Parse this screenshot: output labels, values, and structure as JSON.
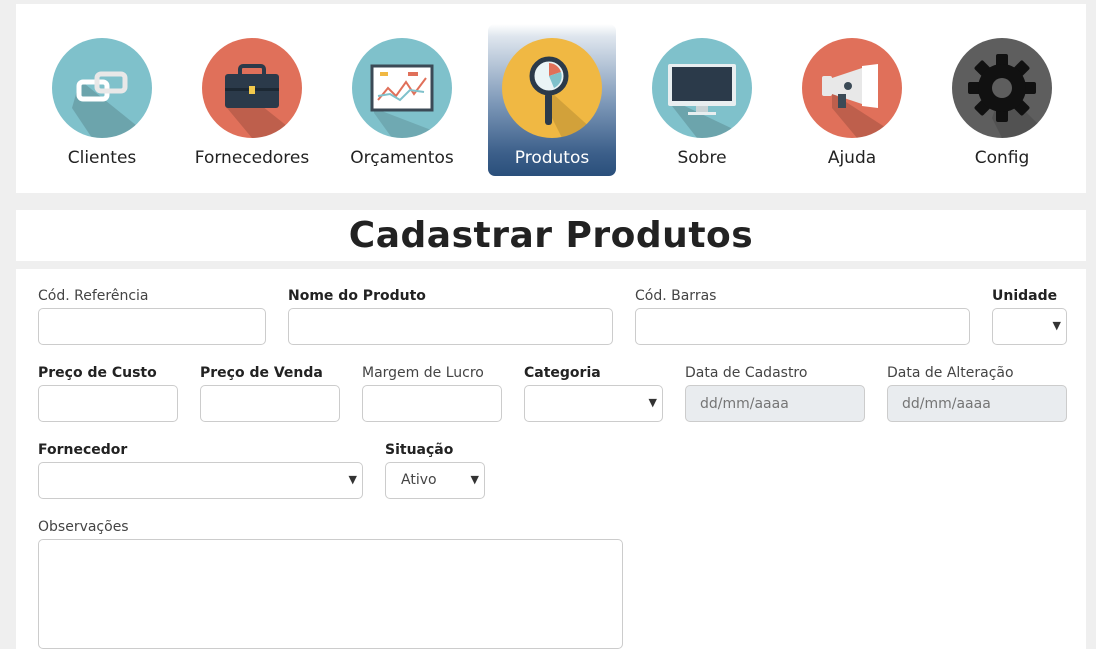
{
  "nav": {
    "items": [
      {
        "label": "Clientes",
        "icon": "link-icon",
        "color": "#7fc1cb"
      },
      {
        "label": "Fornecedores",
        "icon": "briefcase-icon",
        "color": "#e0705a"
      },
      {
        "label": "Orçamentos",
        "icon": "presentation-chart-icon",
        "color": "#7fc1cb"
      },
      {
        "label": "Produtos",
        "icon": "magnifier-icon",
        "color": "#f0b843",
        "active": true
      },
      {
        "label": "Sobre",
        "icon": "monitor-icon",
        "color": "#7fc1cb"
      },
      {
        "label": "Ajuda",
        "icon": "megaphone-icon",
        "color": "#e0705a"
      },
      {
        "label": "Config",
        "icon": "gear-icon",
        "color": "#5e5e5e"
      }
    ]
  },
  "page": {
    "title": "Cadastrar Produtos"
  },
  "form": {
    "cod_referencia": {
      "label": "Cód. Referência",
      "value": ""
    },
    "nome_produto": {
      "label": "Nome do Produto",
      "value": ""
    },
    "cod_barras": {
      "label": "Cód. Barras",
      "value": ""
    },
    "unidade": {
      "label": "Unidade",
      "value": ""
    },
    "preco_custo": {
      "label": "Preço de Custo",
      "value": ""
    },
    "preco_venda": {
      "label": "Preço de Venda",
      "value": ""
    },
    "margem_lucro": {
      "label": "Margem de Lucro",
      "value": ""
    },
    "categoria": {
      "label": "Categoria",
      "value": ""
    },
    "data_cadastro": {
      "label": "Data de Cadastro",
      "placeholder": "dd/mm/aaaa"
    },
    "data_alteracao": {
      "label": "Data de Alteração",
      "placeholder": "dd/mm/aaaa"
    },
    "fornecedor": {
      "label": "Fornecedor",
      "value": ""
    },
    "situacao": {
      "label": "Situação",
      "value": "Ativo"
    },
    "observacoes": {
      "label": "Observações",
      "value": ""
    }
  },
  "colors": {
    "active_tab": "#2a4f7b",
    "background": "#efefef"
  }
}
